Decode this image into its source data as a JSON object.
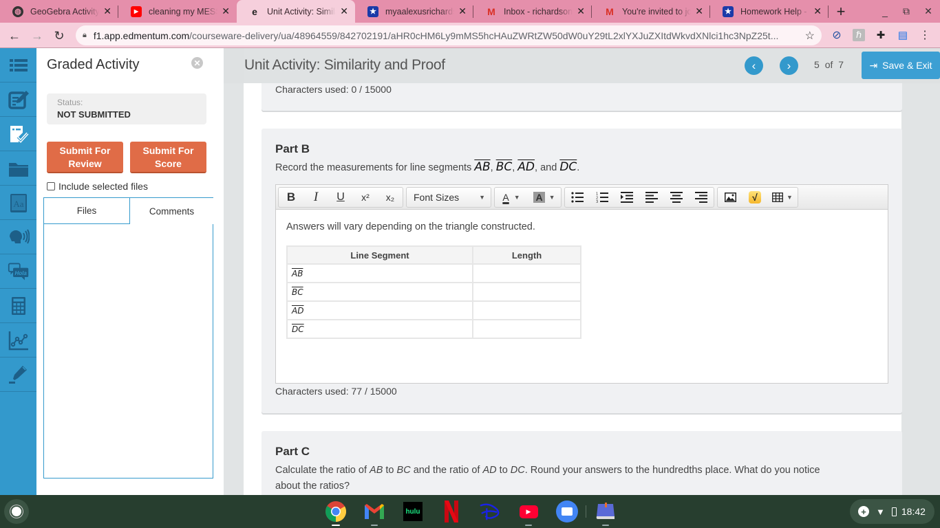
{
  "browser": {
    "tabs": [
      {
        "title": "GeoGebra Activity - ",
        "icon": "globe-icon",
        "active": false
      },
      {
        "title": "cleaning my MESSY",
        "icon": "youtube-icon",
        "active": false
      },
      {
        "title": "Unit Activity: Similarity",
        "icon": "edmentum-icon",
        "active": true
      },
      {
        "title": "myaalexusrichards",
        "icon": "star-shield-icon",
        "active": false
      },
      {
        "title": "Inbox - richardsonm",
        "icon": "gmail-icon",
        "active": false
      },
      {
        "title": "You're invited to join",
        "icon": "gmail-icon",
        "active": false
      },
      {
        "title": "Homework Help - Q",
        "icon": "star-shield-icon",
        "active": false
      }
    ],
    "close_glyph": "✕",
    "new_tab_glyph": "+",
    "url_host": "f1.app.edmentum.com",
    "url_path": "/courseware-delivery/ua/48964559/842702191/aHR0cHM6Ly9mMS5hcHAuZWRtZW50dW0uY29tL2xlYXJuZXItdWkvdXNlci1hc3NpZ25t..."
  },
  "rail": {
    "items": [
      {
        "name": "table-of-contents-icon"
      },
      {
        "name": "notes-icon"
      },
      {
        "name": "graded-activity-icon",
        "active": true
      },
      {
        "name": "folder-icon"
      },
      {
        "name": "dictionary-icon"
      },
      {
        "name": "text-to-speech-icon"
      },
      {
        "name": "translate-icon",
        "label": "Hola"
      },
      {
        "name": "calculator-icon"
      },
      {
        "name": "graph-icon"
      },
      {
        "name": "highlighter-icon"
      }
    ]
  },
  "panel": {
    "title": "Graded Activity",
    "close_glyph": "✕",
    "status_label": "Status:",
    "status_value": "NOT SUBMITTED",
    "submit_review": "Submit For Review",
    "submit_review_l1": "Submit For",
    "submit_review_l2": "Review",
    "submit_score_l1": "Submit For",
    "submit_score_l2": "Score",
    "include_files": "Include selected files",
    "include_files_checked": false,
    "tabs": [
      "Files",
      "Comments"
    ],
    "active_tab": "Comments"
  },
  "header": {
    "title": "Unit Activity: Similarity and Proof",
    "prev_glyph": "‹",
    "next_glyph": "›",
    "page_current": "5",
    "page_of": "of",
    "page_total": "7",
    "save_exit": "Save & Exit"
  },
  "partA": {
    "chars_used": "Characters used: 0 / 15000"
  },
  "partB": {
    "heading": "Part B",
    "prompt_prefix": "Record the measurements for line segments ",
    "segments": [
      "AB",
      "BC",
      "AD",
      "DC"
    ],
    "sep1": ", ",
    "sep2": ", ",
    "sep3": ", and ",
    "end": ".",
    "toolbar": {
      "bold": "B",
      "italic": "I",
      "underline": "U",
      "superscript": "x²",
      "subscript": "x₂",
      "font_sizes": "Font Sizes",
      "font_color": "A",
      "bg_color": "A"
    },
    "answer_text": "Answers will vary depending on the triangle constructed.",
    "table": {
      "headers": [
        "Line Segment",
        "Length"
      ],
      "rows": [
        {
          "segment": "AB",
          "length": ""
        },
        {
          "segment": "BC",
          "length": ""
        },
        {
          "segment": "AD",
          "length": ""
        },
        {
          "segment": "DC",
          "length": ""
        }
      ]
    },
    "chars_used": "Characters used: 77 / 15000"
  },
  "partC": {
    "heading": "Part C",
    "p1": "Calculate the ratio of ",
    "v1": "AB",
    "p2": " to ",
    "v2": "BC",
    "p3": " and the ratio of ",
    "v3": "AD",
    "p4": " to ",
    "v4": "DC",
    "p5": ". Round your answers to the hundredths place. What do you notice",
    "line2": "about the ratios?"
  },
  "shelf": {
    "apps": [
      "chrome",
      "gmail",
      "hulu",
      "netflix",
      "disney-plus",
      "youtube",
      "files",
      "bookmark-app"
    ],
    "hulu_label": "hulu",
    "time": "18:42"
  },
  "colors": {
    "accent": "#3399cc",
    "submit": "#e06c47",
    "tabbar": "#e58fab"
  }
}
